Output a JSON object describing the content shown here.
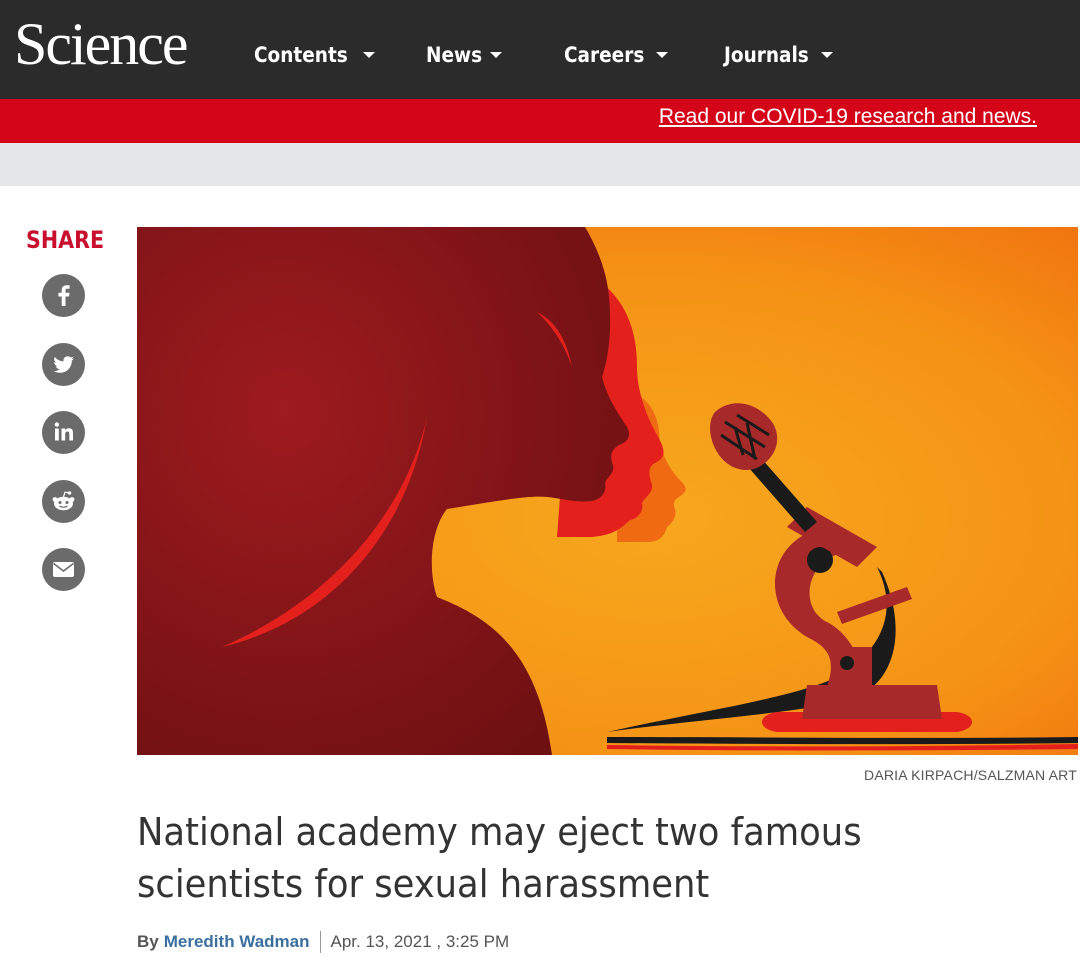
{
  "header": {
    "logo": "Science",
    "nav": [
      {
        "label": "Contents"
      },
      {
        "label": "News"
      },
      {
        "label": "Careers"
      },
      {
        "label": "Journals"
      }
    ]
  },
  "banner": {
    "covid_link": "Read our COVID-19 research and news."
  },
  "share": {
    "title": "SHARE",
    "buttons": [
      "facebook-icon",
      "twitter-icon",
      "linkedin-icon",
      "reddit-icon",
      "email-icon"
    ]
  },
  "article": {
    "image_credit": "DARIA KIRPACH/SALZMAN ART",
    "headline": "National academy may eject two famous scientists for sexual harassment",
    "byline_prefix": "By",
    "author": "Meredith Wadman",
    "date": "Apr. 13, 2021 , 3:25 PM"
  },
  "colors": {
    "topbar": "#2b2b2b",
    "banner_red": "#d40519",
    "share_red": "#c8102e",
    "author_link": "#3a6fa0"
  }
}
